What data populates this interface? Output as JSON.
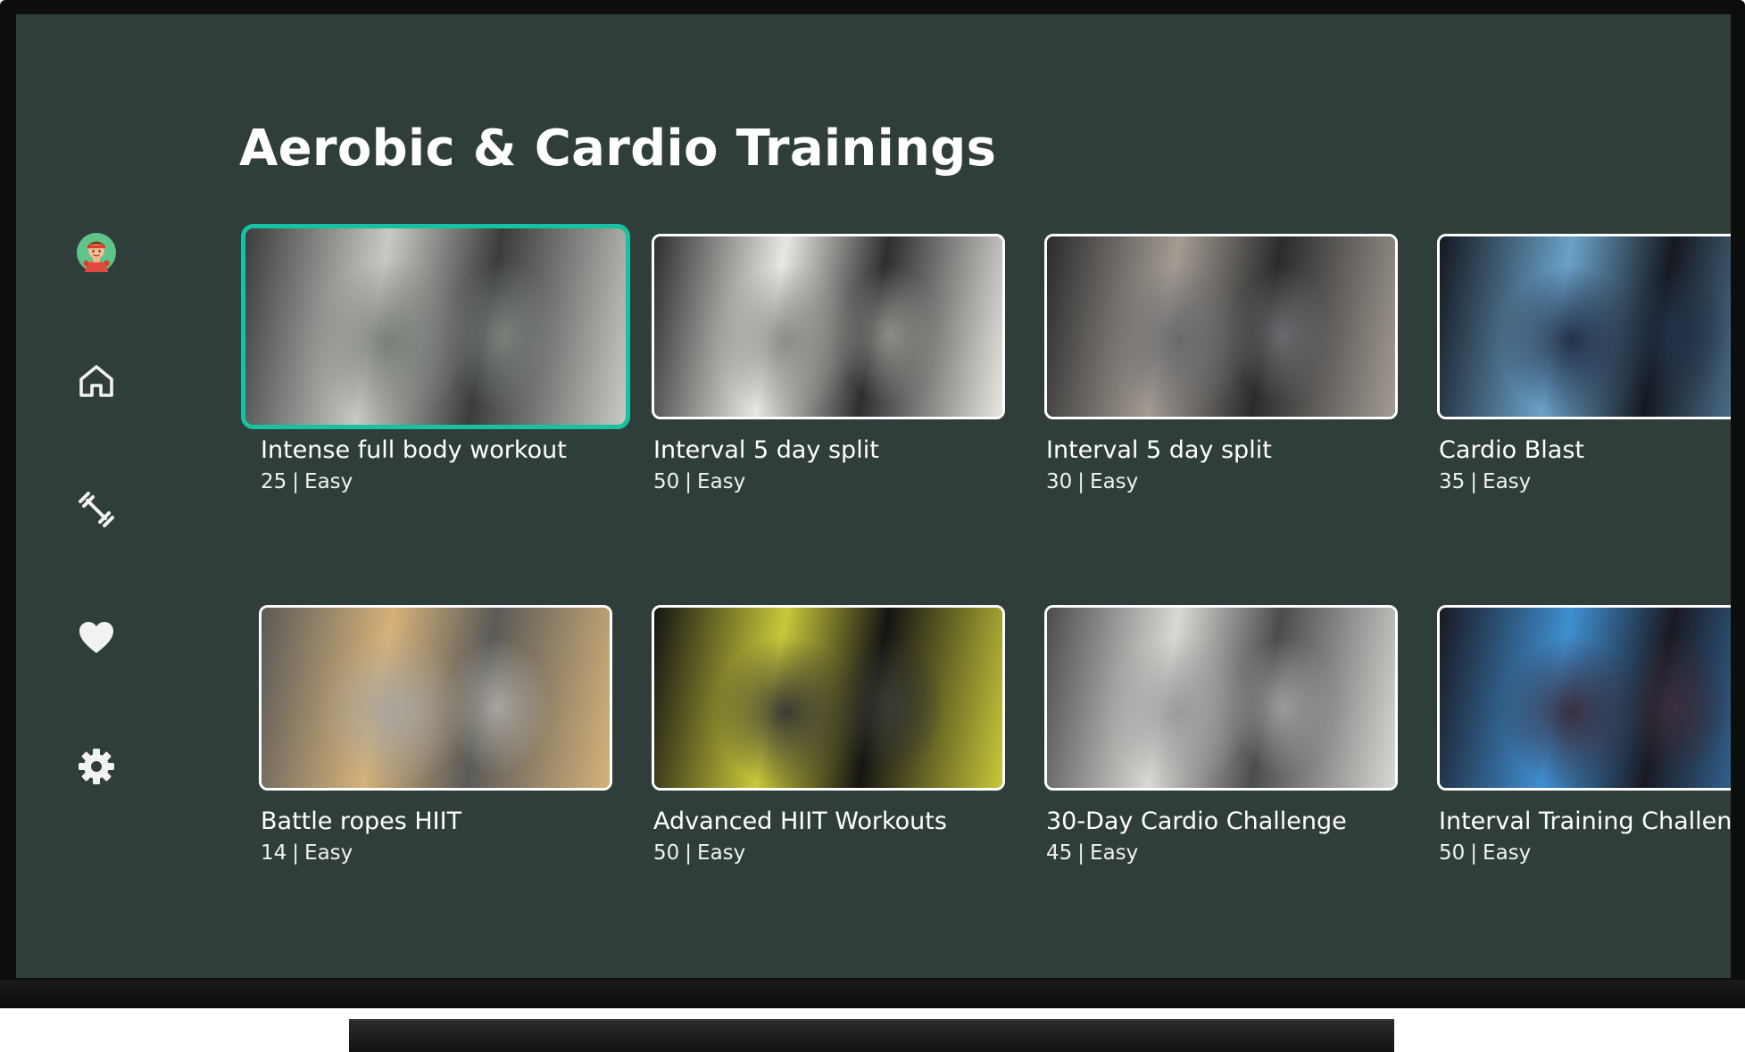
{
  "header": {
    "title": "Aerobic & Cardio Trainings"
  },
  "sidebar": {
    "items": [
      {
        "name": "profile-avatar",
        "icon": "avatar-icon"
      },
      {
        "name": "home",
        "icon": "home-icon"
      },
      {
        "name": "workouts",
        "icon": "dumbbell-icon"
      },
      {
        "name": "favorites",
        "icon": "heart-icon"
      },
      {
        "name": "settings",
        "icon": "gear-icon"
      }
    ]
  },
  "workouts": [
    {
      "title": "Intense full body workout",
      "count": "25",
      "level": "Easy",
      "focused": true,
      "palette": [
        "#3a3d3c",
        "#7a7f7a",
        "#c9c9c4"
      ]
    },
    {
      "title": "Interval 5 day split",
      "count": "50",
      "level": "Easy",
      "palette": [
        "#2e2e2e",
        "#8c8c88",
        "#e9e7e2"
      ]
    },
    {
      "title": "Interval 5 day split",
      "count": "30",
      "level": "Easy",
      "palette": [
        "#2b2b2d",
        "#6a6a6e",
        "#a29c92"
      ]
    },
    {
      "title": "Cardio Blast",
      "count": "35",
      "level": "Easy",
      "palette": [
        "#151820",
        "#24324a",
        "#6aa2c9"
      ]
    },
    {
      "title": "Battle ropes HIIT",
      "count": "14",
      "level": "Easy",
      "palette": [
        "#5a5a58",
        "#a8a59e",
        "#d6b27a"
      ]
    },
    {
      "title": "Advanced HIIT Workouts",
      "count": "50",
      "level": "Easy",
      "palette": [
        "#141414",
        "#3b3b34",
        "#c9c83a"
      ]
    },
    {
      "title": "30-Day Cardio Challenge",
      "count": "45",
      "level": "Easy",
      "palette": [
        "#4b4c4c",
        "#9a9c9b",
        "#d8d9d4"
      ]
    },
    {
      "title": "Interval Training Challenge",
      "count": "50",
      "level": "Easy",
      "palette": [
        "#1a1922",
        "#3a2f3e",
        "#3f8fd1"
      ]
    }
  ],
  "colors": {
    "background": "#2f3e3a",
    "focus_ring": "#17c2a3",
    "icon": "#f2f2f2"
  }
}
